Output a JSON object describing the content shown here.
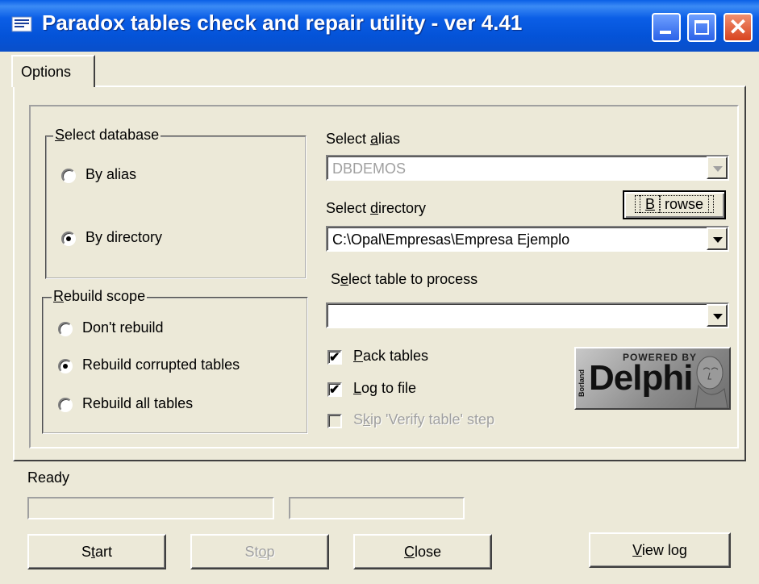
{
  "window": {
    "title": "Paradox tables check and repair utility - ver 4.41",
    "icon": "app-icon",
    "controls": [
      "minimize-icon",
      "maximize-icon",
      "close-icon"
    ]
  },
  "tabs": [
    {
      "label": "Options",
      "selected": true
    }
  ],
  "select_database": {
    "title_prefix": "",
    "title_mnemonic": "S",
    "title_rest": "elect database",
    "options": [
      {
        "label": "By alias",
        "selected": false
      },
      {
        "label": "By directory",
        "selected": true
      }
    ]
  },
  "rebuild_scope": {
    "title_mnemonic": "R",
    "title_rest": "ebuild scope",
    "options": [
      {
        "label": "Don't rebuild",
        "selected": false
      },
      {
        "label": "Rebuild corrupted tables",
        "selected": true
      },
      {
        "label": "Rebuild all tables",
        "selected": false
      }
    ]
  },
  "alias": {
    "label_pre": "Select ",
    "label_mnemonic": "a",
    "label_post": "lias",
    "value": "DBDEMOS",
    "enabled": false
  },
  "directory": {
    "label_pre": "Select ",
    "label_mnemonic": "d",
    "label_post": "irectory",
    "value": "C:\\Opal\\Empresas\\Empresa Ejemplo",
    "browse_mnemonic": "B",
    "browse_rest": "rowse"
  },
  "table": {
    "label_pre": "S",
    "label_mnemonic": "e",
    "label_post": "lect table to process",
    "value": ""
  },
  "checks": [
    {
      "mnemonic": "P",
      "rest": "ack tables",
      "checked": true,
      "enabled": true
    },
    {
      "mnemonic": "L",
      "rest": "og to file",
      "checked": true,
      "enabled": true
    },
    {
      "pre": "S",
      "mnemonic": "k",
      "rest": "ip 'Verify table' step",
      "checked": false,
      "enabled": false
    }
  ],
  "logo": {
    "powered": "POWERED BY",
    "word": "Delphi",
    "vendor": "Borland"
  },
  "status_text": "Ready",
  "buttons": {
    "start": {
      "pre": "S",
      "mnemonic": "t",
      "rest": "art"
    },
    "stop": {
      "pre": "St",
      "mnemonic": "o",
      "rest": "p"
    },
    "close": {
      "pre": "",
      "mnemonic": "C",
      "rest": "lose"
    },
    "view_log": {
      "pre": "",
      "mnemonic": "V",
      "rest": "iew log"
    }
  }
}
